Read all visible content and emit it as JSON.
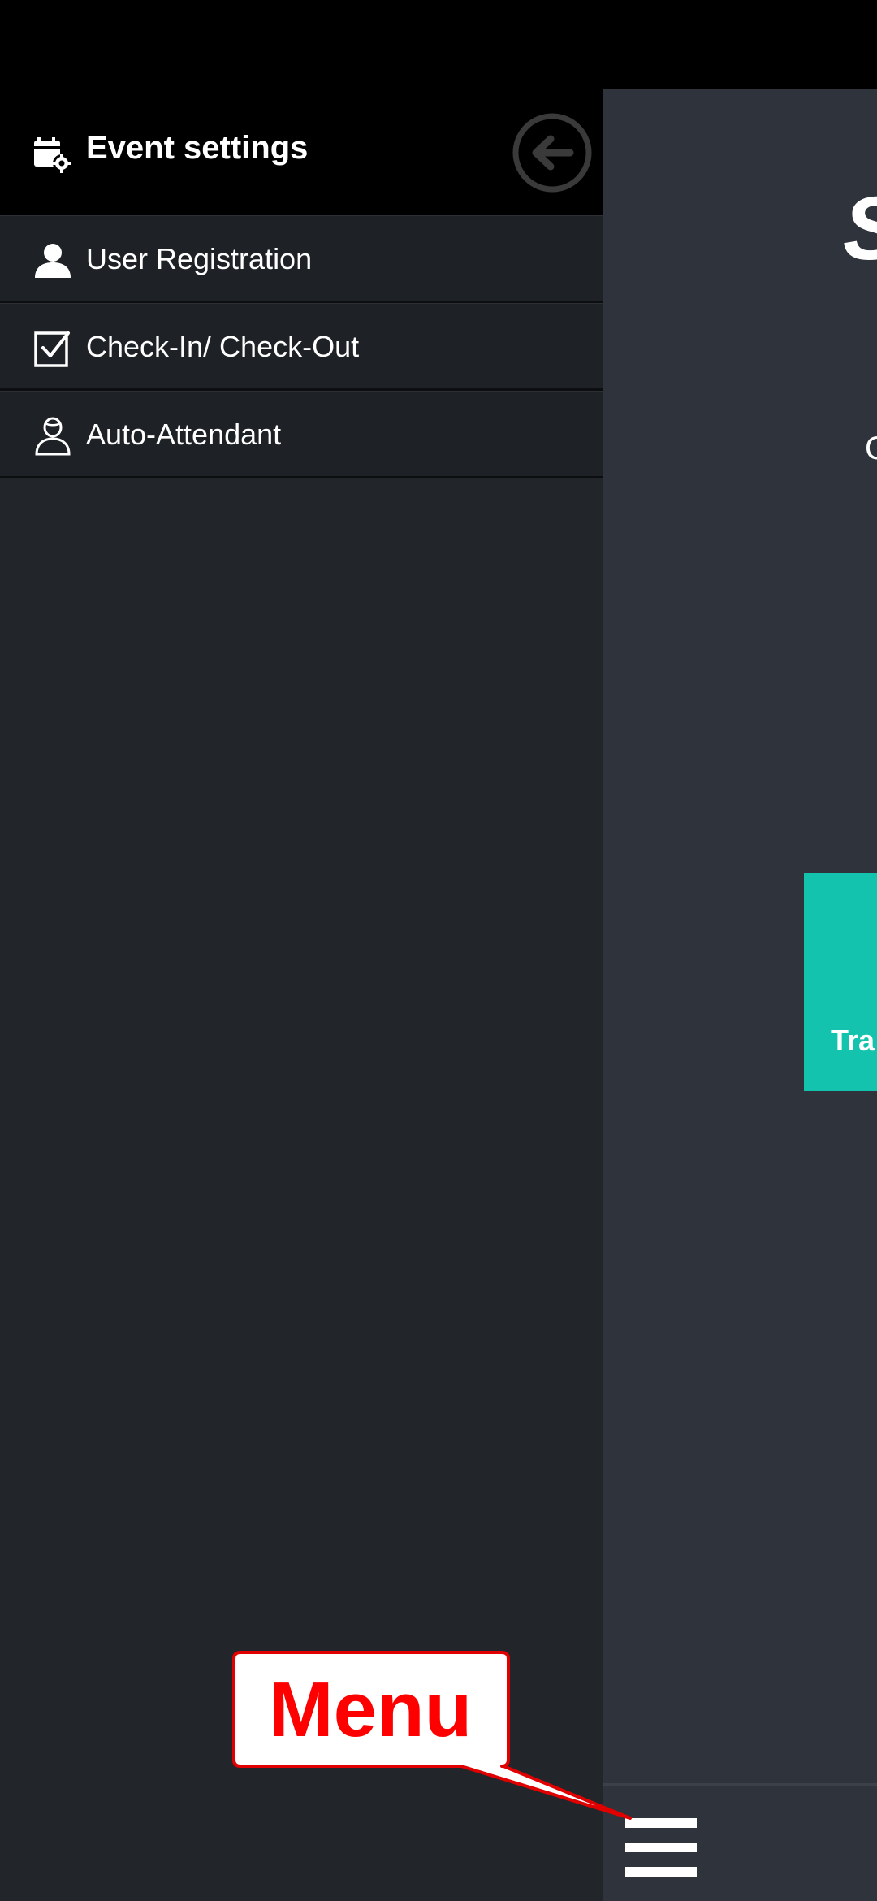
{
  "drawer": {
    "title": "Event settings",
    "header_icon": "calendar-gear-icon",
    "back_icon": "arrow-left-circle-icon",
    "items": [
      {
        "label": "User Registration",
        "icon": "user-icon"
      },
      {
        "label": "Check-In/ Check-Out",
        "icon": "checkbox-icon"
      },
      {
        "label": "Auto-Attendant",
        "icon": "person-outline-icon"
      }
    ]
  },
  "main": {
    "title_partial": "S",
    "letter_partial": "C",
    "tile_label_partial": "Tra",
    "menu_icon": "hamburger-menu-icon"
  },
  "callout": {
    "text": "Menu"
  },
  "colors": {
    "drawer_bg": "#222529",
    "header_bg": "#000000",
    "main_bg": "#2f333b",
    "tile": "#14c3ae",
    "callout_text": "#ff0000",
    "callout_border": "#e00000"
  }
}
